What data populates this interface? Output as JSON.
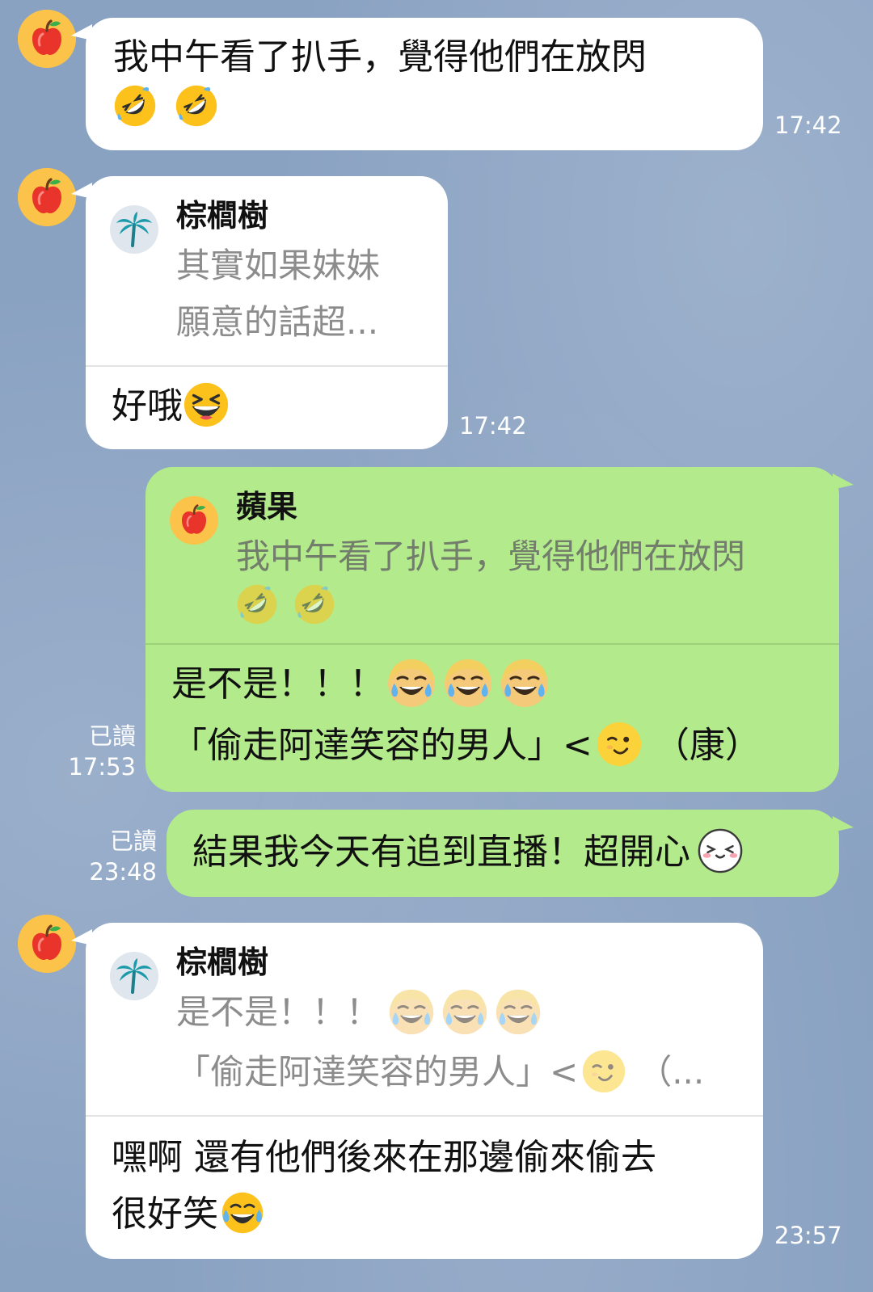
{
  "chat": {
    "msg1": {
      "line1": "我中午看了扒手，覺得他們在放閃",
      "emoji": "rolling-on-floor-laughing",
      "time": "17:42"
    },
    "msg2": {
      "quote_name": "棕櫚樹",
      "quote_line1": "其實如果妹妹",
      "quote_line2": "願意的話超...",
      "text": "好哦",
      "emoji": "grinning-squinting-face",
      "time": "17:42"
    },
    "msg3": {
      "quote_name": "蘋果",
      "quote_line1": "我中午看了扒手，覺得他們在放閃",
      "text_line1": "是不是！！！",
      "text_line2_a": "「偷走阿達笑容的男人」<",
      "text_line2_b": "（康）",
      "read_label": "已讀",
      "time": "17:53"
    },
    "msg4": {
      "text": "結果我今天有追到直播！超開心",
      "read_label": "已讀",
      "time": "23:48"
    },
    "msg5": {
      "quote_name": "棕櫚樹",
      "quote_line1": "是不是！！！",
      "quote_line2_a": "「偷走阿達笑容的男人」<",
      "quote_line2_b": "（...",
      "text_line1": "嘿啊 還有他們後來在那邊偷來偷去",
      "text_line2": "很好笑",
      "time": "23:57"
    }
  },
  "colors": {
    "background": "#8aa2c2",
    "incoming_bubble": "#ffffff",
    "outgoing_bubble": "#b3ea8b",
    "quote_text": "#8c8c8c",
    "timestamp": "#ffffff"
  }
}
